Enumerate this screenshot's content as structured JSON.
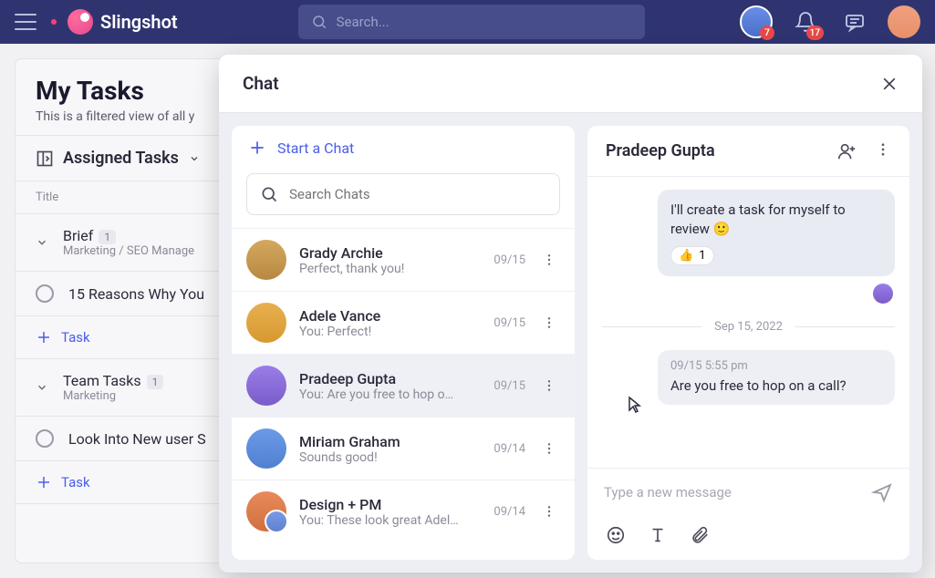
{
  "topbar": {
    "brand": "Slingshot",
    "search_placeholder": "Search...",
    "avatar_badge": "7",
    "bell_badge": "17"
  },
  "tasks": {
    "title": "My Tasks",
    "subtitle": "This is a filtered view of all y",
    "section": "Assigned Tasks",
    "col_title": "Title",
    "rows": [
      {
        "name": "Brief",
        "count": "1",
        "sub": "Marketing / SEO Manage"
      },
      {
        "name": "15 Reasons Why You"
      },
      {
        "name_add": "Task"
      },
      {
        "name": "Team Tasks",
        "count": "1",
        "sub": "Marketing"
      },
      {
        "name": "Look Into New user S"
      },
      {
        "name_add": "Task"
      }
    ]
  },
  "chat": {
    "header": "Chat",
    "start": "Start a Chat",
    "search_placeholder": "Search Chats",
    "items": [
      {
        "name": "Grady Archie",
        "preview": "Perfect, thank you!",
        "date": "09/15"
      },
      {
        "name": "Adele Vance",
        "preview": "You: Perfect!",
        "date": "09/15"
      },
      {
        "name": "Pradeep Gupta",
        "preview": "You: Are you free to hop o…",
        "date": "09/15"
      },
      {
        "name": "Miriam Graham",
        "preview": "Sounds good!",
        "date": "09/14"
      },
      {
        "name": "Design + PM",
        "preview": "You: These look great Adel…",
        "date": "09/14"
      }
    ]
  },
  "conversation": {
    "title": "Pradeep Gupta",
    "msg1": "I'll create a task for myself to review 🙂",
    "reaction_count": "1",
    "divider_date": "Sep 15, 2022",
    "msg2_ts": "09/15 5:55 pm",
    "msg2": "Are you free to hop on a call?",
    "composer_placeholder": "Type a new message"
  }
}
